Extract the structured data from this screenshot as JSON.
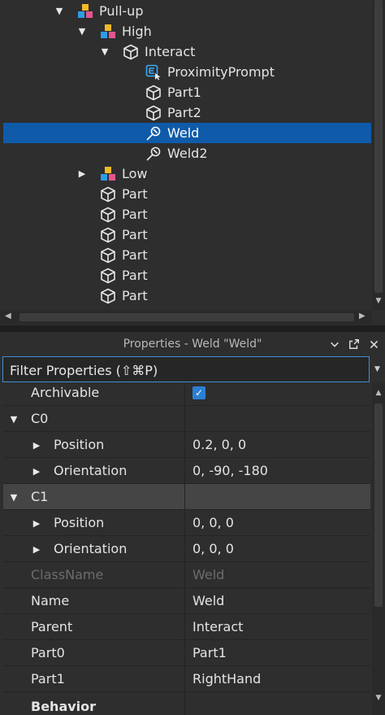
{
  "explorer": {
    "items": [
      {
        "label": "Pull-up",
        "icon": "model-icon",
        "expanded": true
      },
      {
        "label": "High",
        "icon": "model-icon",
        "expanded": true
      },
      {
        "label": "Interact",
        "icon": "part-icon",
        "expanded": true
      },
      {
        "label": "ProximityPrompt",
        "icon": "proximity-prompt-icon"
      },
      {
        "label": "Part1",
        "icon": "part-icon"
      },
      {
        "label": "Part2",
        "icon": "part-icon"
      },
      {
        "label": "Weld",
        "icon": "weld-icon",
        "selected": true
      },
      {
        "label": "Weld2",
        "icon": "weld-icon"
      },
      {
        "label": "Low",
        "icon": "model-icon",
        "expanded": false
      },
      {
        "label": "Part",
        "icon": "part-icon"
      },
      {
        "label": "Part",
        "icon": "part-icon"
      },
      {
        "label": "Part",
        "icon": "part-icon"
      },
      {
        "label": "Part",
        "icon": "part-icon"
      },
      {
        "label": "Part",
        "icon": "part-icon"
      },
      {
        "label": "Part",
        "icon": "part-icon"
      }
    ]
  },
  "properties": {
    "title": "Properties - Weld \"Weld\"",
    "filter_placeholder": "Filter Properties (⇧⌘P)",
    "rows": [
      {
        "name": "Archivable",
        "value": "",
        "checked": true
      },
      {
        "name": "C0",
        "value": ""
      },
      {
        "name": "Position",
        "value": "0.2, 0, 0"
      },
      {
        "name": "Orientation",
        "value": "0, -90, -180"
      },
      {
        "name": "C1",
        "value": ""
      },
      {
        "name": "Position",
        "value": "0, 0, 0"
      },
      {
        "name": "Orientation",
        "value": "0, 0, 0"
      },
      {
        "name": "ClassName",
        "value": "Weld"
      },
      {
        "name": "Name",
        "value": "Weld"
      },
      {
        "name": "Parent",
        "value": "Interact"
      },
      {
        "name": "Part0",
        "value": "Part1"
      },
      {
        "name": "Part1",
        "value": "RightHand"
      },
      {
        "name": "Behavior",
        "value": ""
      }
    ]
  },
  "colors": {
    "selection": "#0f5baa",
    "model_blue": "#2e9be6",
    "model_yellow": "#f2b92a",
    "model_pink": "#e2568f",
    "prompt_blue": "#3da9f5",
    "checkbox": "#2b7fd4"
  }
}
